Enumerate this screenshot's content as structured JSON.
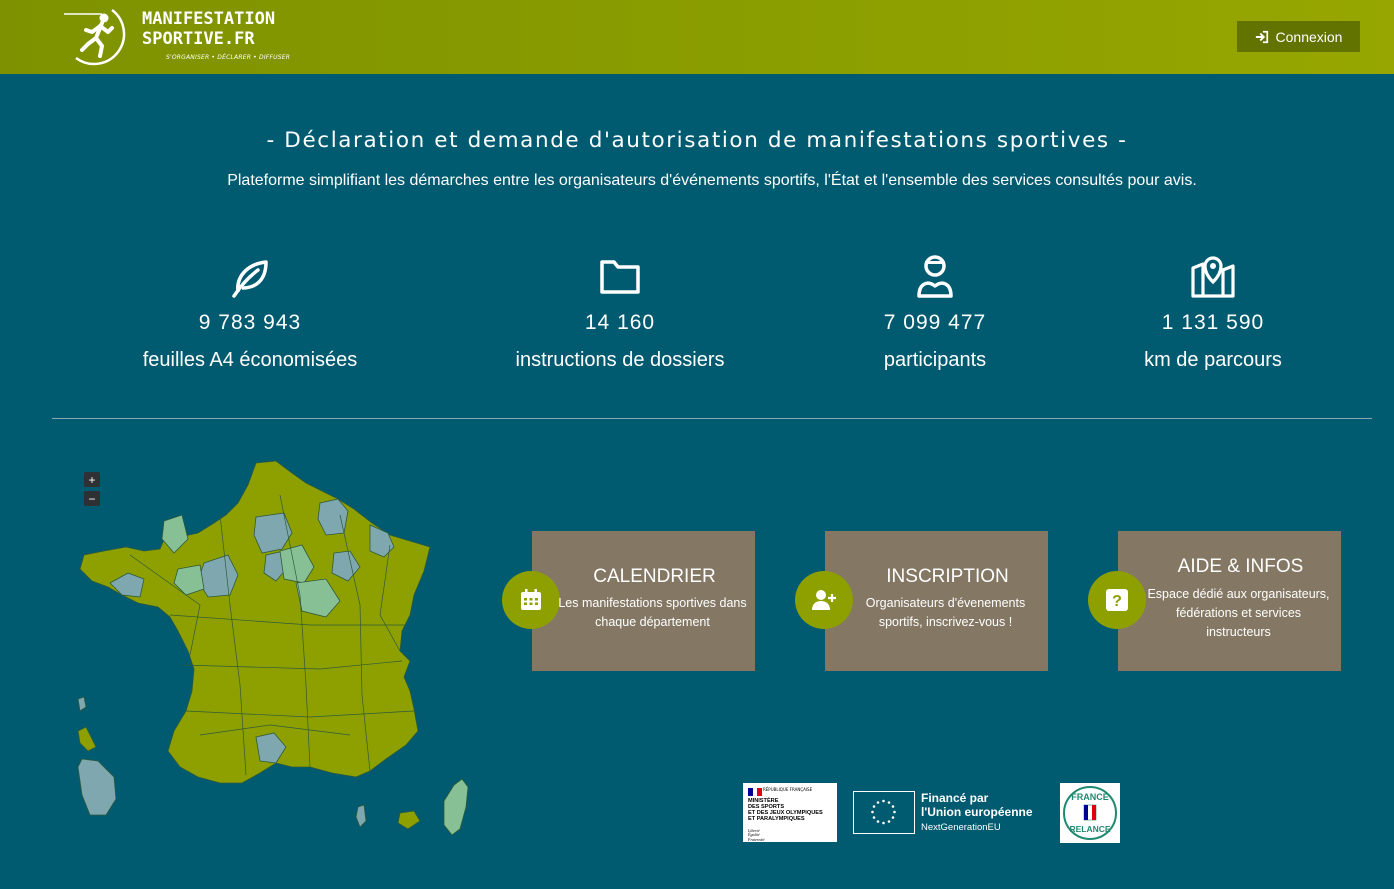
{
  "header": {
    "logo_line1": "MANIFESTATION",
    "logo_line2": "SPORTIVE.FR",
    "logo_tagline": "S'ORGANISER • DÉCLARER • DIFFUSER",
    "login_label": "Connexion"
  },
  "hero": {
    "title": "- Déclaration et demande d'autorisation de manifestations sportives -",
    "subtitle": "Plateforme simplifiant les démarches entre les organisateurs d'événements sportifs, l'État et l'ensemble des services consultés pour avis."
  },
  "stats": [
    {
      "icon": "leaf-icon",
      "value": "9 783 943",
      "label": "feuilles A4 économisées"
    },
    {
      "icon": "folder-icon",
      "value": "14 160",
      "label": "instructions de dossiers"
    },
    {
      "icon": "runner-icon",
      "value": "7 099 477",
      "label": "participants"
    },
    {
      "icon": "map-marker-icon",
      "value": "1 131 590",
      "label": "km de parcours"
    }
  ],
  "map": {
    "zoom_in": "+",
    "zoom_out": "−"
  },
  "cards": [
    {
      "icon": "calendar-icon",
      "title": "CALENDRIER",
      "description": "Les manifestations sportives dans chaque département"
    },
    {
      "icon": "add-user-icon",
      "title": "INSCRIPTION",
      "description": "Organisateurs d'évenements sportifs, inscrivez-vous !"
    },
    {
      "icon": "question-icon",
      "title": "AIDE & INFOS",
      "description": "Espace dédié aux organisateurs, fédérations et services instructeurs"
    }
  ],
  "partners": {
    "ministry_rf": "RÉPUBLIQUE FRANÇAISE",
    "ministry_line1": "MINISTÈRE",
    "ministry_line2": "DES SPORTS",
    "ministry_line3": "ET DES JEUX OLYMPIQUES",
    "ministry_line4": "ET PARALYMPIQUES",
    "ministry_motto1": "Liberté",
    "ministry_motto2": "Égalité",
    "ministry_motto3": "Fraternité",
    "eu_line1": "Financé par",
    "eu_line2": "l'Union européenne",
    "eu_line3": "NextGenerationEU",
    "relance_line1": "FRANCE",
    "relance_line2": "RELANCE"
  },
  "colors": {
    "background": "#005a70",
    "header": "#8c9f00",
    "button": "#627300",
    "card": "#847865",
    "accent": "#8da000",
    "map_green": "#8da000",
    "map_blue": "#7ea7b0",
    "map_pale": "#88c095"
  }
}
